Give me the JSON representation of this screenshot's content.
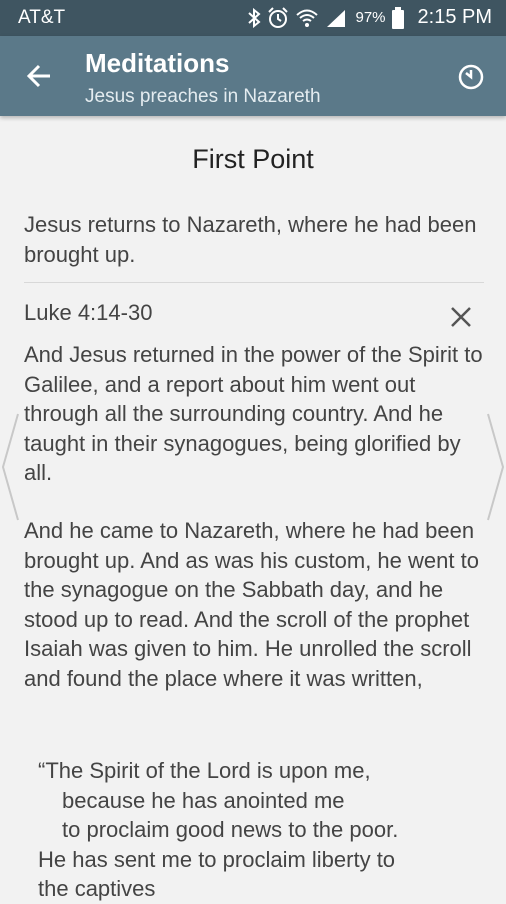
{
  "status": {
    "carrier": "AT&T",
    "battery": "97%",
    "time": "2:15 PM"
  },
  "appbar": {
    "title": "Meditations",
    "subtitle": "Jesus preaches in Nazareth"
  },
  "content": {
    "point_title": "First Point",
    "point_text": "Jesus returns to Nazareth, where he had been brought up.",
    "reference": "Luke 4:14-30",
    "paragraph1": "And Jesus returned in the power of the Spirit to Galilee, and a report about him went out through all the surrounding country. And he taught in their synagogues, being glorified by all.",
    "paragraph2": "And he came to Nazareth, where he had been brought up. And as was his custom, he went to the synagogue on the Sabbath day, and he stood up to read. And the scroll of the prophet Isaiah was given to him. He unrolled the scroll and found the place where it was written,",
    "quote": [
      "“The Spirit of the Lord is upon me,",
      "because he has anointed me",
      "to proclaim good news to the poor.",
      "He has sent me to proclaim liberty to",
      "the captives"
    ]
  },
  "icons": {
    "back": "arrow-back-icon",
    "timer": "timer-icon",
    "close": "close-icon",
    "prev": "chevron-left-icon",
    "next": "chevron-right-icon"
  }
}
